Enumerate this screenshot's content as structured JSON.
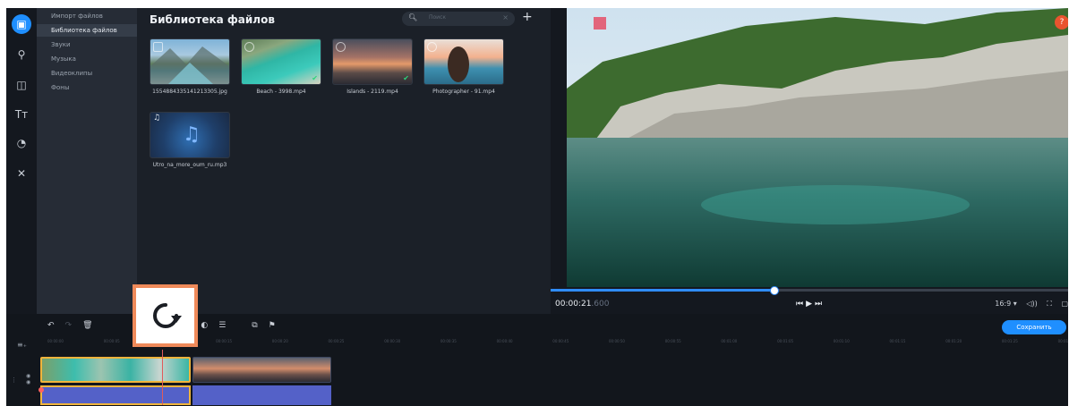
{
  "sidebar": {
    "categories": [
      "Импорт файлов",
      "Библиотека файлов",
      "Звуки",
      "Музыка",
      "Видеоклипы",
      "Фоны"
    ]
  },
  "library": {
    "title": "Библиотека файлов",
    "search_placeholder": "Поиск",
    "files": [
      {
        "name": "1554884335141213305.jpg"
      },
      {
        "name": "Beach - 3998.mp4"
      },
      {
        "name": "Islands - 2119.mp4"
      },
      {
        "name": "Photographer - 91.mp4"
      },
      {
        "name": "Utro_na_more_oum_ru.mp3"
      }
    ]
  },
  "player": {
    "time": "00:00:21",
    "time_ms": ".600",
    "aspect": "16:9 ▾",
    "progress": 0.43
  },
  "timeline": {
    "save_label": "Сохранить",
    "ticks": [
      "00:00:00",
      "00:00:05",
      "00:00:10",
      "00:00:15",
      "00:00:20",
      "00:00:25",
      "00:00:30",
      "00:00:35",
      "00:00:40",
      "00:00:45",
      "00:00:50",
      "00:00:55",
      "00:01:00",
      "00:01:05",
      "00:01:10",
      "00:01:15",
      "00:01:20",
      "00:01:25",
      "00:01:30",
      "00:01:35"
    ]
  },
  "colors": {
    "accent": "#1f8fff",
    "highlight": "#ef8a5a",
    "selection": "#f0b43c",
    "audio": "#5461c8"
  }
}
